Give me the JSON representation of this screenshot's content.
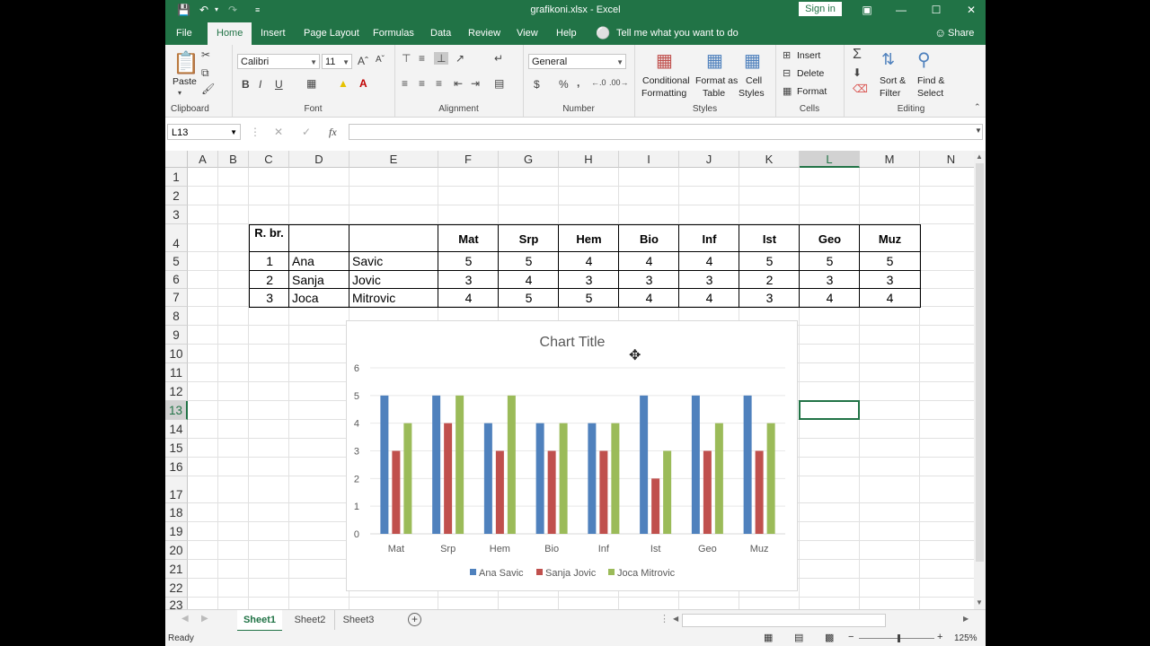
{
  "titlebar": {
    "title": "grafikoni.xlsx  -  Excel",
    "sign_in": "Sign in"
  },
  "tabs": [
    {
      "label": "File"
    },
    {
      "label": "Home"
    },
    {
      "label": "Insert"
    },
    {
      "label": "Page Layout"
    },
    {
      "label": "Formulas"
    },
    {
      "label": "Data"
    },
    {
      "label": "Review"
    },
    {
      "label": "View"
    },
    {
      "label": "Help"
    }
  ],
  "tell_me": "Tell me what you want to do",
  "share": "Share",
  "ribbon": {
    "paste": "Paste",
    "clipboard": "Clipboard",
    "font_name": "Calibri",
    "font_size": "11",
    "bold": "B",
    "italic": "I",
    "underline": "U",
    "font": "Font",
    "alignment": "Alignment",
    "number_format": "General",
    "currency": "$",
    "percent": "%",
    "comma": ",",
    "number": "Number",
    "conditional_1": "Conditional",
    "conditional_2": "Formatting",
    "format_table_1": "Format as",
    "format_table_2": "Table",
    "cell_styles_1": "Cell",
    "cell_styles_2": "Styles",
    "styles": "Styles",
    "insert": "Insert",
    "delete": "Delete",
    "format": "Format",
    "cells": "Cells",
    "sort_1": "Sort &",
    "sort_2": "Filter",
    "find_1": "Find &",
    "find_2": "Select",
    "editing": "Editing"
  },
  "formula": {
    "name_box": "L13",
    "fx": "fx",
    "cancel": "✕",
    "enter": "✓"
  },
  "columns": [
    "A",
    "B",
    "C",
    "D",
    "E",
    "F",
    "G",
    "H",
    "I",
    "J",
    "K",
    "L",
    "M",
    "N"
  ],
  "rows": [
    "1",
    "2",
    "3",
    "4",
    "5",
    "6",
    "7",
    "8",
    "9",
    "10",
    "11",
    "12",
    "13",
    "14",
    "15",
    "16",
    "17",
    "18",
    "19",
    "20",
    "21",
    "22",
    "23"
  ],
  "table": {
    "header_rb": "R. br.",
    "subjects": [
      "Mat",
      "Srp",
      "Hem",
      "Bio",
      "Inf",
      "Ist",
      "Geo",
      "Muz"
    ],
    "students": [
      {
        "no": "1",
        "first": "Ana",
        "last": "Savic",
        "grades": [
          "5",
          "5",
          "4",
          "4",
          "4",
          "5",
          "5",
          "5"
        ]
      },
      {
        "no": "2",
        "first": "Sanja",
        "last": "Jovic",
        "grades": [
          "3",
          "4",
          "3",
          "3",
          "3",
          "2",
          "3",
          "3"
        ]
      },
      {
        "no": "3",
        "first": "Joca",
        "last": "Mitrovic",
        "grades": [
          "4",
          "5",
          "5",
          "4",
          "4",
          "3",
          "4",
          "4"
        ]
      }
    ]
  },
  "chart_data": {
    "type": "bar",
    "title": "Chart Title",
    "categories": [
      "Mat",
      "Srp",
      "Hem",
      "Bio",
      "Inf",
      "Ist",
      "Geo",
      "Muz"
    ],
    "series": [
      {
        "name": "Ana Savic",
        "values": [
          5,
          5,
          4,
          4,
          4,
          5,
          5,
          5
        ],
        "color": "#4f81bd"
      },
      {
        "name": "Sanja Jovic",
        "values": [
          3,
          4,
          3,
          3,
          3,
          2,
          3,
          3
        ],
        "color": "#c0504d"
      },
      {
        "name": "Joca Mitrovic",
        "values": [
          4,
          5,
          5,
          4,
          4,
          3,
          4,
          4
        ],
        "color": "#9bbb59"
      }
    ],
    "ylim": [
      0,
      6
    ],
    "yticks": [
      "0",
      "1",
      "2",
      "3",
      "4",
      "5",
      "6"
    ],
    "grid": true,
    "legend": "bottom"
  },
  "sheets": [
    {
      "label": "Sheet1"
    },
    {
      "label": "Sheet2"
    },
    {
      "label": "Sheet3"
    }
  ],
  "status": {
    "ready": "Ready",
    "zoom": "125%"
  },
  "colors": {
    "excel_green": "#217346"
  }
}
